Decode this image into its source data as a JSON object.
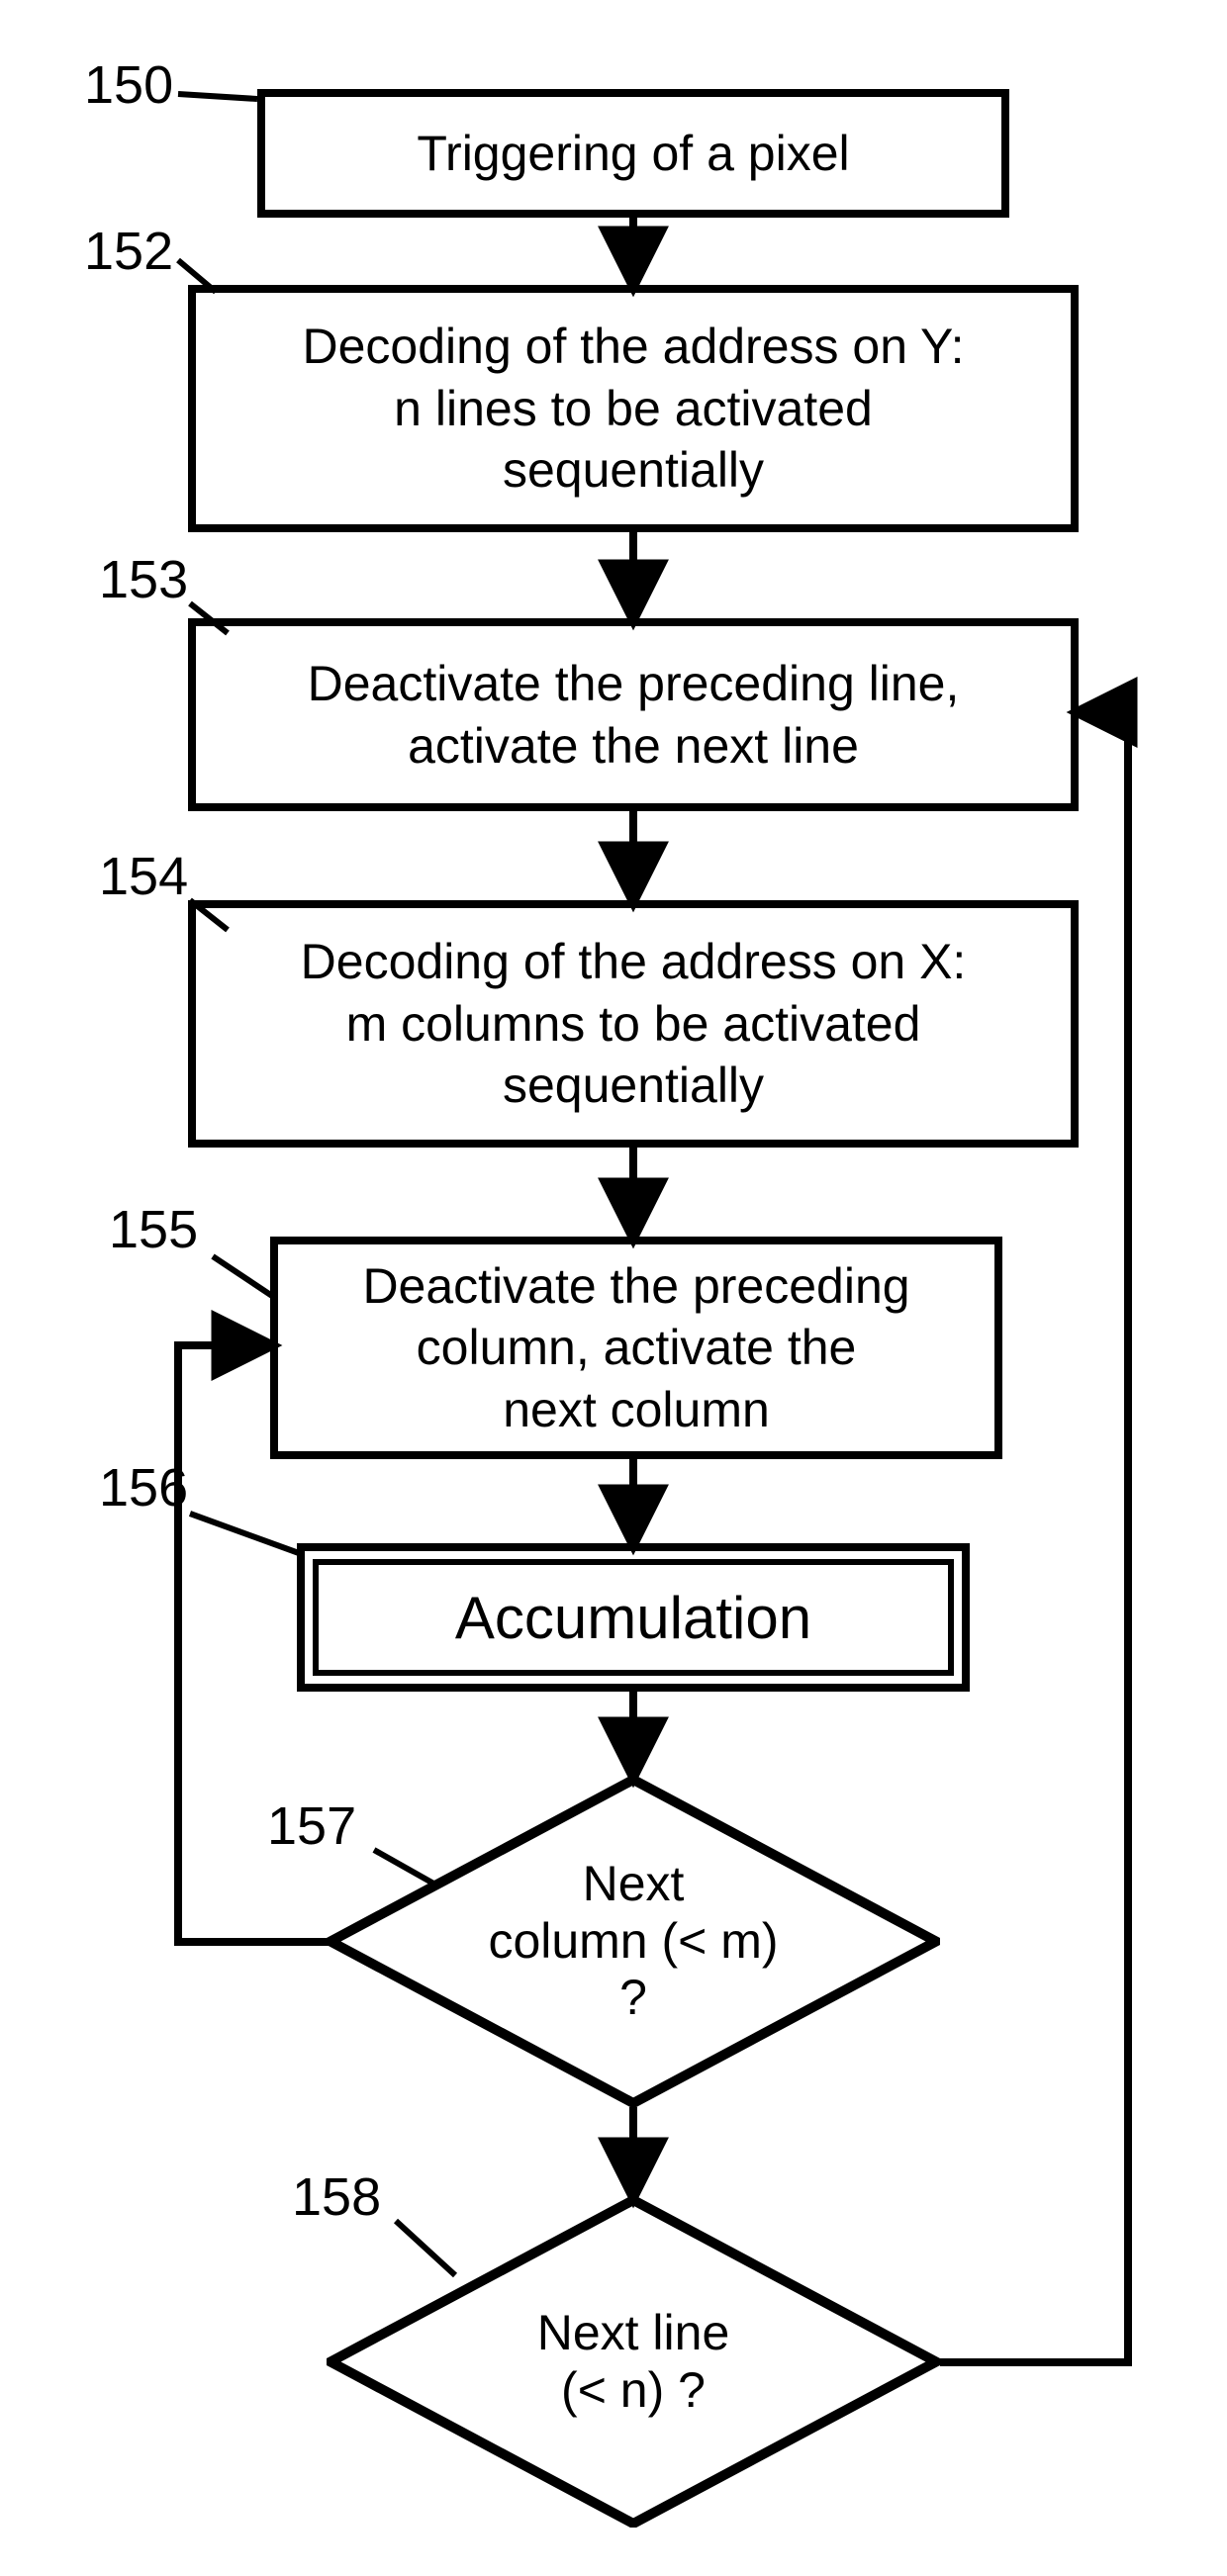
{
  "labels": {
    "n150": "150",
    "n152": "152",
    "n153": "153",
    "n154": "154",
    "n155": "155",
    "n156": "156",
    "n157": "157",
    "n158": "158"
  },
  "steps": {
    "s150": "Triggering of a pixel",
    "s152": "Decoding of the address on Y:\nn lines to be activated\nsequentially",
    "s153": "Deactivate the preceding line,\nactivate the next line",
    "s154": "Decoding of the address on X:\nm columns to be activated\nsequentially",
    "s155": "Deactivate the preceding\ncolumn, activate the\nnext column",
    "s156": "Accumulation",
    "s157": "Next\ncolumn (< m)\n?",
    "s158": "Next line\n(< n) ?"
  }
}
